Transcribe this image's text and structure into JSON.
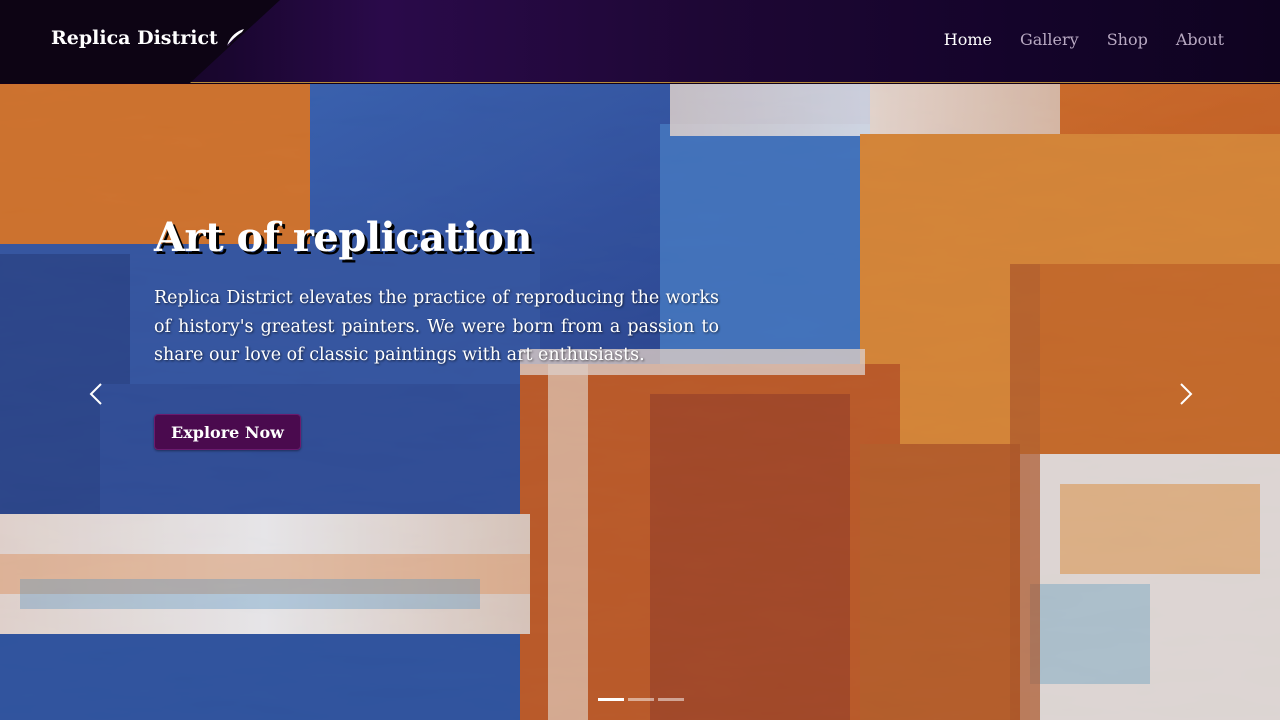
{
  "brand": {
    "name": "Replica District",
    "icon": "quill-icon"
  },
  "nav": {
    "items": [
      {
        "label": "Home",
        "active": true
      },
      {
        "label": "Gallery",
        "active": false
      },
      {
        "label": "Shop",
        "active": false
      },
      {
        "label": "About",
        "active": false
      }
    ]
  },
  "hero": {
    "title": "Art of replication",
    "text": "Replica District elevates the practice of reproducing the works of history's greatest painters. We were born from a passion to share our love of classic paintings with art enthusiasts.",
    "button_label": "Explore Now",
    "prev_icon": "chevron-left-icon",
    "next_icon": "chevron-right-icon",
    "slide_count": 3,
    "active_slide": 1
  },
  "colors": {
    "navbar_bg": "#1e0735",
    "navbar_border": "#b58a3c",
    "button_bg": "#4a0a4e",
    "nav_active": "#ffffff",
    "nav_inactive": "#b8a9c2"
  }
}
